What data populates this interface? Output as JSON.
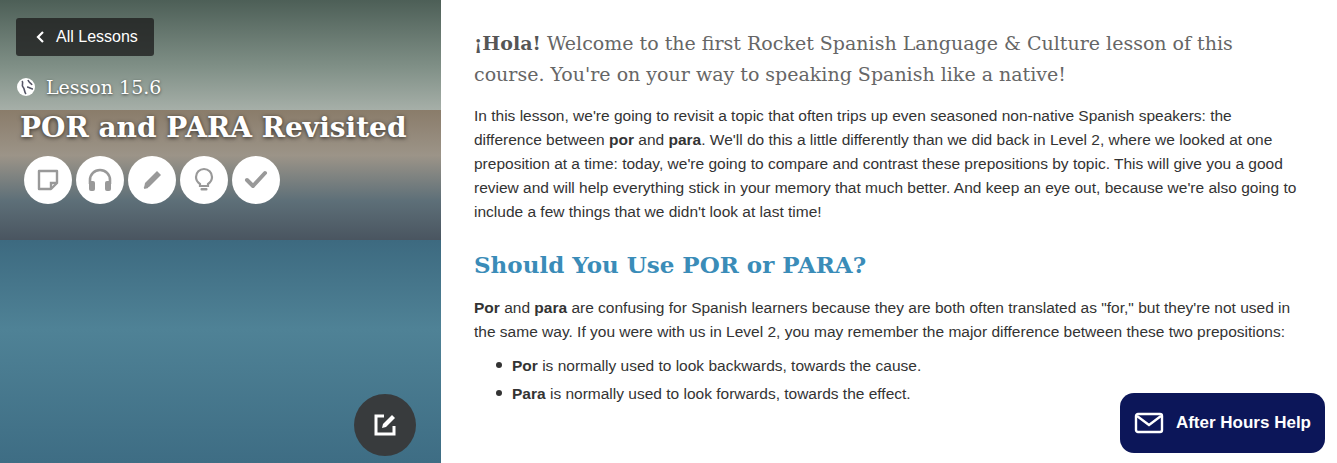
{
  "nav": {
    "back_label": "All Lessons"
  },
  "lesson": {
    "number": "Lesson 15.6",
    "title": "POR and PARA Revisited"
  },
  "content": [
    {
      "kind": "lead",
      "segments": [
        {
          "text": "¡Hola!",
          "bold": true
        },
        {
          "text": " Welcome to the first Rocket Spanish Language & Culture lesson of this course. You're on your way to speaking Spanish like a native!",
          "bold": false
        }
      ]
    },
    {
      "kind": "paragraph",
      "segments": [
        {
          "text": "In this lesson, we're going to revisit a topic that often trips up even seasoned non-native Spanish speakers: the difference between ",
          "bold": false
        },
        {
          "text": "por",
          "bold": true
        },
        {
          "text": " and ",
          "bold": false
        },
        {
          "text": "para",
          "bold": true
        },
        {
          "text": ". We'll do this a little differently than we did back in Level 2, where we looked at one preposition at a time: today, we're going to compare and contrast these prepositions by topic. This will give you a good review and will help everything stick in your memory that much better. And keep an eye out, because we're also going to include a few things that we didn't look at last time!",
          "bold": false
        }
      ]
    },
    {
      "kind": "heading",
      "segments": [
        {
          "text": "Should You Use POR or PARA?",
          "bold": true
        }
      ]
    },
    {
      "kind": "paragraph",
      "segments": [
        {
          "text": "Por",
          "bold": true
        },
        {
          "text": " and ",
          "bold": false
        },
        {
          "text": "para",
          "bold": true
        },
        {
          "text": " are confusing for Spanish learners because they are both often translated as \"for,\" but they're not used in the same way. If you were with us in Level 2, you may remember the major difference between these two prepositions:",
          "bold": false
        }
      ]
    },
    {
      "kind": "bullet",
      "segments": [
        {
          "text": "Por",
          "bold": true
        },
        {
          "text": " is normally used to look backwards, towards the cause.",
          "bold": false
        }
      ]
    },
    {
      "kind": "bullet",
      "segments": [
        {
          "text": "Para",
          "bold": true
        },
        {
          "text": " is normally used to look forwards, towards the effect.",
          "bold": false
        }
      ]
    }
  ],
  "help_button": {
    "label": "After Hours Help"
  }
}
